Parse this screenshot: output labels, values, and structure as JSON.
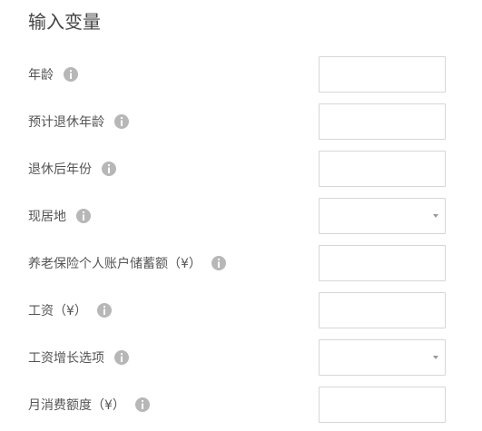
{
  "form": {
    "title": "输入变量",
    "fields": [
      {
        "label": "年龄",
        "type": "input",
        "value": "",
        "info_icon": "info-icon"
      },
      {
        "label": "预计退休年龄",
        "type": "input",
        "value": "",
        "info_icon": "info-icon"
      },
      {
        "label": "退休后年份",
        "type": "input",
        "value": "",
        "info_icon": "info-icon"
      },
      {
        "label": "现居地",
        "type": "select",
        "value": "",
        "info_icon": "info-icon"
      },
      {
        "label": "养老保险个人账户储蓄额（¥）",
        "type": "input",
        "value": "",
        "info_icon": "info-icon"
      },
      {
        "label": "工资（¥）",
        "type": "input",
        "value": "",
        "info_icon": "info-icon"
      },
      {
        "label": "工资增长选项",
        "type": "select",
        "value": "",
        "info_icon": "info-icon"
      },
      {
        "label": "月消费额度（¥）",
        "type": "input",
        "value": "",
        "info_icon": "info-icon"
      }
    ]
  },
  "colors": {
    "label_text": "#555555",
    "info_icon_bg": "#b7b7b7",
    "field_border": "#d6d6d6",
    "caret": "#9a9a9a"
  }
}
